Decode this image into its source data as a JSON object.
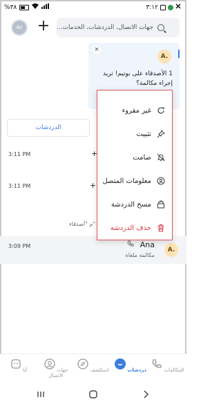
{
  "status_bar": {
    "battery_text": "%٣٨",
    "time": "٣:١٢"
  },
  "header": {
    "avatar_initials": "AV",
    "add_label": "+",
    "search_placeholder": "جهات الاتصال، الدردشات، الخدمات..."
  },
  "banner": {
    "avatar_letter": "A.",
    "message": "1 الأصدقاء على بوتيم! تريد إجراء مكالمة؟",
    "close_label": "×"
  },
  "tabs": {
    "active_label": "الدردشات"
  },
  "chat_rows": [
    {
      "time": "3:11 PM",
      "fragment": "+"
    },
    {
      "time": "3:11 PM",
      "fragment": "+9"
    },
    {
      "time": "",
      "fragment": "م \"أصدقاء\""
    }
  ],
  "chat_ana": {
    "time": "3:09 PM",
    "name": "Ana",
    "subtitle": "مكالمة ملغاة",
    "avatar_letter": "A."
  },
  "context_menu": {
    "items": [
      {
        "label": "غير مقروء",
        "icon": "mark-unread-icon"
      },
      {
        "label": "تثبيت",
        "icon": "pin-icon"
      },
      {
        "label": "صامت",
        "icon": "mute-bell-icon"
      },
      {
        "label": "معلومات المتصل",
        "icon": "contact-info-icon"
      },
      {
        "label": "مسح الدردشة",
        "icon": "clear-chat-icon"
      },
      {
        "label": "حذف الدردشة",
        "icon": "trash-icon"
      }
    ]
  },
  "bottom_nav": {
    "items": [
      {
        "label": "المكالمات"
      },
      {
        "label": "دردشات"
      },
      {
        "label": "استكشف"
      },
      {
        "label": "جهات الاتصال"
      },
      {
        "label": "أنا"
      }
    ]
  },
  "colors": {
    "accent": "#3b7ddd",
    "danger": "#d9363e",
    "banner_bg": "#eef5fc"
  }
}
